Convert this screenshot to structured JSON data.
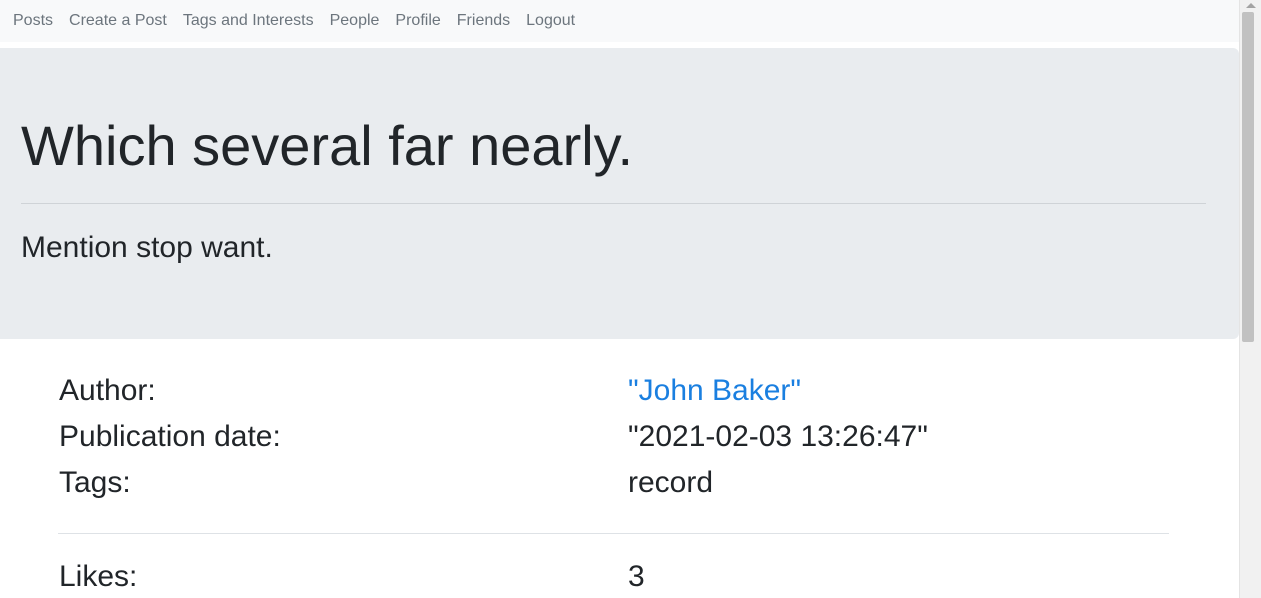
{
  "nav": {
    "items": [
      {
        "label": "Posts"
      },
      {
        "label": "Create a Post"
      },
      {
        "label": "Tags and Interests"
      },
      {
        "label": "People"
      },
      {
        "label": "Profile"
      },
      {
        "label": "Friends"
      },
      {
        "label": "Logout"
      }
    ]
  },
  "post": {
    "title": "Which several far nearly.",
    "body": "Mention stop want."
  },
  "details": {
    "author_label": "Author:",
    "author_value": "\"John Baker\"",
    "date_label": "Publication date:",
    "date_value": "\"2021-02-03 13:26:47\"",
    "tags_label": "Tags:",
    "tags_value": "record",
    "likes_label": "Likes:",
    "likes_value": "3"
  },
  "colors": {
    "link": "#1a7fe0",
    "jumbotron_bg": "#e9ecef",
    "navbar_bg": "#f8f9fa",
    "nav_text": "#6c757d"
  }
}
